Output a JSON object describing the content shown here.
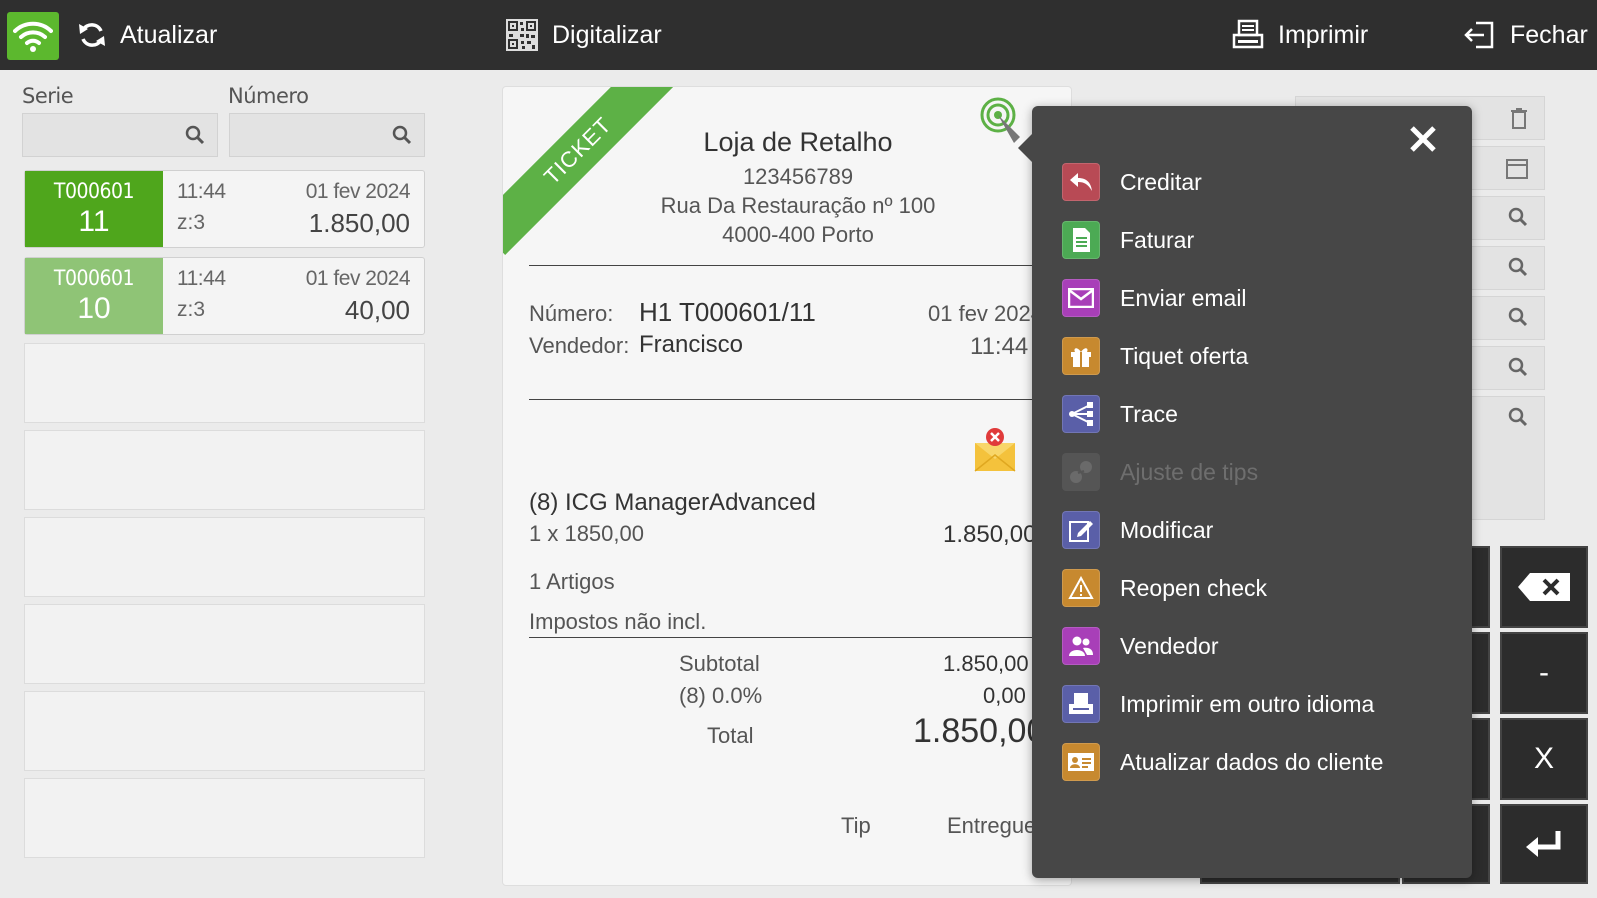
{
  "topbar": {
    "refresh_label": "Atualizar",
    "scan_label": "Digitalizar",
    "print_label": "Imprimir",
    "close_label": "Fechar"
  },
  "filters": {
    "serie_label": "Serie",
    "numero_label": "Número",
    "serie_value": "",
    "numero_value": ""
  },
  "documents": [
    {
      "serie": "T000601",
      "number": "11",
      "time": "11:44",
      "z": "z:3",
      "date": "01 fev 2024",
      "amount": "1.850,00",
      "color": "#4fa61c"
    },
    {
      "serie": "T000601",
      "number": "10",
      "time": "11:44",
      "z": "z:3",
      "date": "01 fev 2024",
      "amount": "40,00",
      "color": "#8fc476"
    }
  ],
  "ticket": {
    "ribbon": "TICKET",
    "store_name": "Loja de Retalho",
    "store_nif": "123456789",
    "store_address": "Rua Da Restauração nº 100",
    "store_city": "4000-400 Porto",
    "numero_label": "Número:",
    "numero_value": "H1 T000601/11",
    "date": "01 fev 2024",
    "vendedor_label": "Vendedor:",
    "vendedor_value": "Francisco",
    "time": "11:44",
    "item_name": "(8) ICG ManagerAdvanced",
    "item_qty": "1 x 1850,00",
    "item_total": "1.850,00",
    "artigos": "1 Artigos",
    "impostos": "Impostos não incl.",
    "subtotal_label": "Subtotal",
    "subtotal_value": "1.850,00",
    "tax_label": "(8) 0.0%",
    "tax_value": "0,00",
    "total_label": "Total",
    "total_value": "1.850,00",
    "tip_label": "Tip",
    "entregue_label": "Entregue"
  },
  "keypad": {
    "minus": "-",
    "x": "X"
  },
  "menu": {
    "items": [
      {
        "label": "Creditar",
        "color": "#b84a55",
        "icon": "undo-arrow-icon",
        "enabled": true
      },
      {
        "label": "Faturar",
        "color": "#4caa54",
        "icon": "invoice-icon",
        "enabled": true
      },
      {
        "label": "Enviar email",
        "color": "#a83fb8",
        "icon": "envelope-icon",
        "enabled": true
      },
      {
        "label": "Tiquet oferta",
        "color": "#c7892f",
        "icon": "gift-icon",
        "enabled": true
      },
      {
        "label": "Trace",
        "color": "#5a5fa8",
        "icon": "trace-icon",
        "enabled": true
      },
      {
        "label": "Ajuste de tips",
        "color": "#5b5b5b",
        "icon": "coins-icon",
        "enabled": false
      },
      {
        "label": "Modificar",
        "color": "#5a5fa8",
        "icon": "edit-icon",
        "enabled": true
      },
      {
        "label": "Reopen check",
        "color": "#c7892f",
        "icon": "warning-icon",
        "enabled": true
      },
      {
        "label": "Vendedor",
        "color": "#a83fb8",
        "icon": "users-icon",
        "enabled": true
      },
      {
        "label": "Imprimir em outro idioma",
        "color": "#5a5fa8",
        "icon": "printer-icon",
        "enabled": true
      },
      {
        "label": "Atualizar dados do cliente",
        "color": "#c7892f",
        "icon": "id-card-icon",
        "enabled": true
      }
    ]
  }
}
